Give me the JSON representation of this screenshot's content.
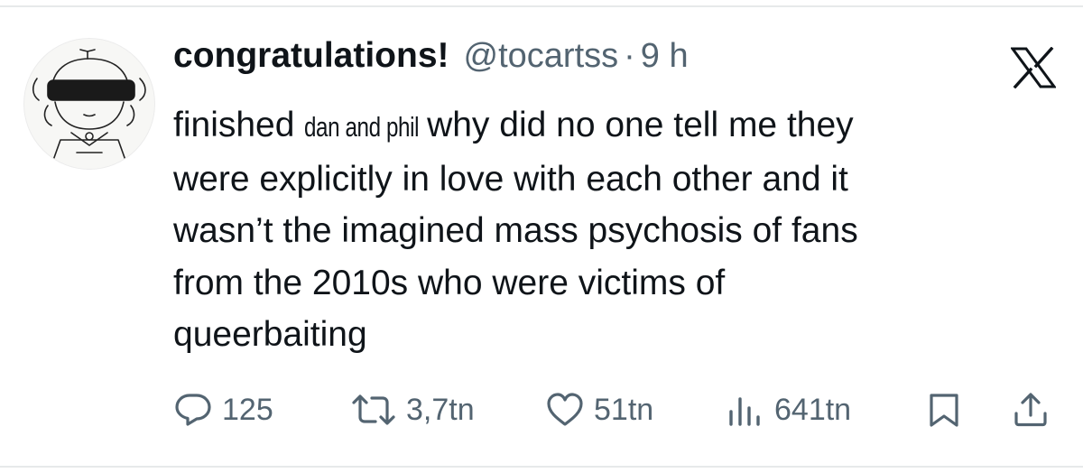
{
  "tweet": {
    "display_name": "congratulations!",
    "handle": "@tocartss",
    "separator": "·",
    "time": "9 h",
    "body": {
      "line1_before": "finished",
      "line1_highlight": "dan and phil",
      "line1_after": "why did no one tell me they",
      "line2": "were explicitly in love with each other and it",
      "line3": "wasn’t the imagined mass psychosis of fans",
      "line4": "from the 2010s who were victims of",
      "line5": "queerbaiting"
    }
  },
  "actions": {
    "replies": "125",
    "reposts": "3,7tn",
    "likes": "51tn",
    "views": "641tn"
  },
  "icons": {
    "brand": "x-logo-icon",
    "reply": "reply-icon",
    "repost": "repost-icon",
    "like": "heart-icon",
    "views": "views-icon",
    "bookmark": "bookmark-icon",
    "share": "share-icon"
  },
  "colors": {
    "text": "#0f1419",
    "muted": "#536471",
    "divider": "#e7e9ea"
  }
}
